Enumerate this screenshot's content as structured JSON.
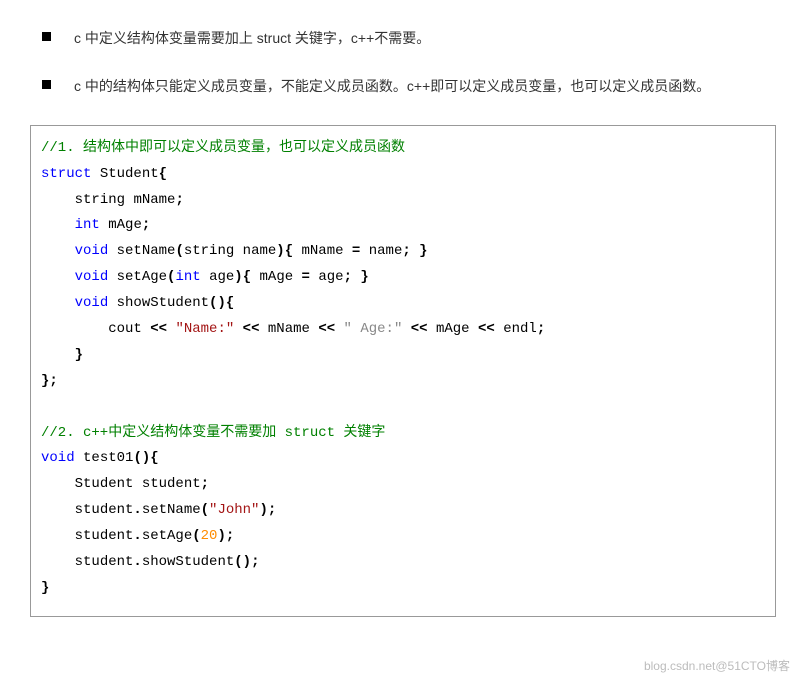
{
  "bullets": {
    "b1": "c 中定义结构体变量需要加上 struct 关键字，c++不需要。",
    "b2": "c 中的结构体只能定义成员变量，不能定义成员函数。c++即可以定义成员变量，也可以定义成员函数。"
  },
  "code": {
    "c1_comment": "//1. 结构体中即可以定义成员变量，也可以定义成员函数",
    "kw_struct": "struct",
    "id_student": "Student",
    "lbrace": "{",
    "rbrace": "}",
    "semi": ";",
    "rbrace_semi": "};",
    "ty_string": "string",
    "id_mname": "mName",
    "ty_int": "int",
    "id_mage": "mAge",
    "ty_void": "void",
    "fn_setname": "setName",
    "lp": "(",
    "rp": ")",
    "param_name": "name",
    "op_assign": "=",
    "fn_setage": "setAge",
    "param_age": "age",
    "fn_showstudent": "showStudent",
    "fn_empty_args": "()",
    "id_cout": "cout",
    "op_shl": "<<",
    "str_name": "\"Name:\"",
    "str_age": "\" Age:\"",
    "id_endl": "endl",
    "c2_comment": "//2. c++中定义结构体变量不需要加 struct 关键字",
    "fn_test01": "test01",
    "id_student_var": "student",
    "dot": ".",
    "str_john": "\"John\"",
    "num_20": "20"
  },
  "watermark": "blog.csdn.net@51CTO博客"
}
